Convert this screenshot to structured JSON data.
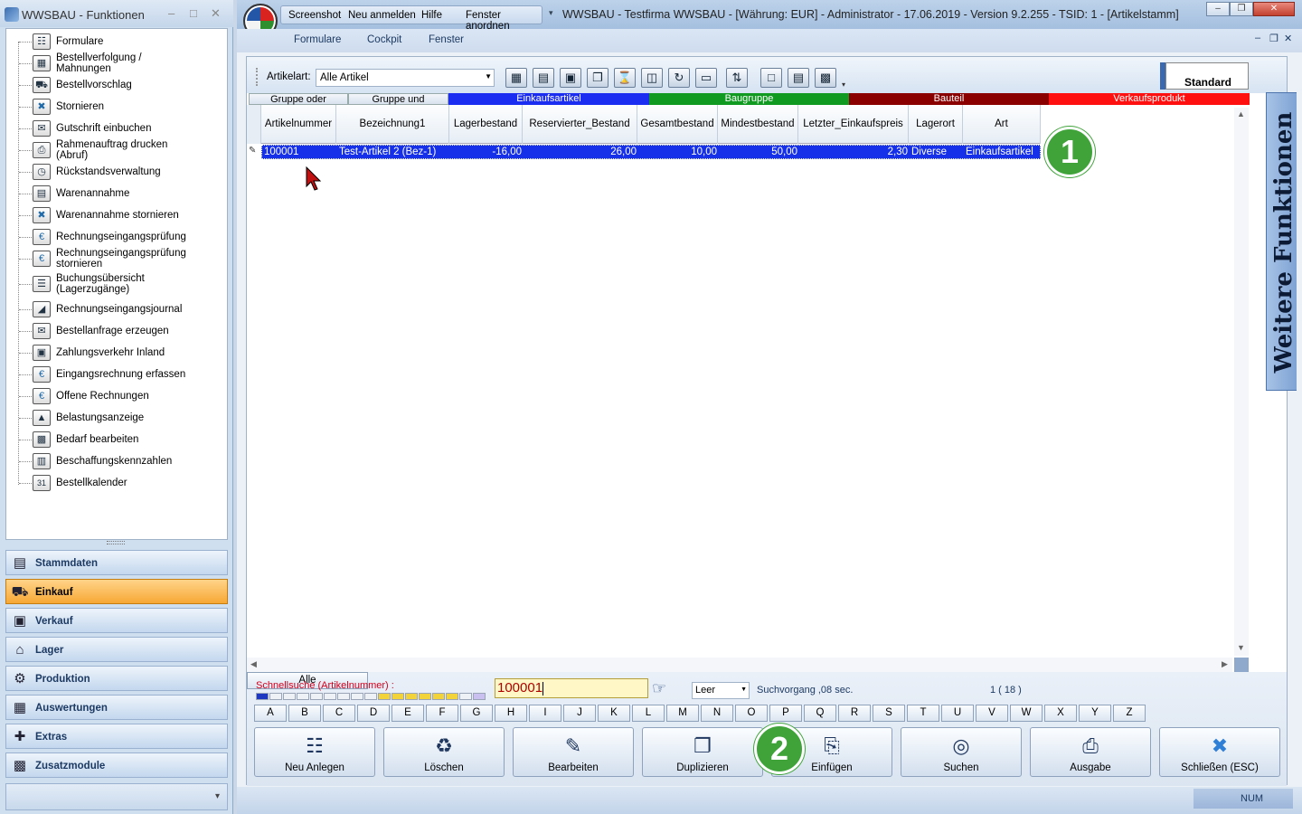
{
  "left_window": {
    "title": "WWSBAU - Funktionen",
    "tree_items": [
      {
        "label": "Formulare",
        "icon": "document-icon"
      },
      {
        "label": "Bestellverfolgung / Mahnungen",
        "icon": "map-icon"
      },
      {
        "label": "Bestellvorschlag",
        "icon": "cart-icon"
      },
      {
        "label": "Stornieren",
        "icon": "cart-cancel-icon"
      },
      {
        "label": "Gutschrift einbuchen",
        "icon": "credit-icon"
      },
      {
        "label": "Rahmenauftrag drucken (Abruf)",
        "icon": "print-doc-icon"
      },
      {
        "label": "Rückstandsverwaltung",
        "icon": "clock-icon"
      },
      {
        "label": "Warenannahme",
        "icon": "goods-icon"
      },
      {
        "label": "Warenannahme stornieren",
        "icon": "goods-cancel-icon"
      },
      {
        "label": "Rechnungseingangsprüfung",
        "icon": "euro-doc-icon"
      },
      {
        "label": "Rechnungseingangsprüfung stornieren",
        "icon": "euro-cancel-icon"
      },
      {
        "label": "Buchungsübersicht (Lagerzugänge)",
        "icon": "list-icon"
      },
      {
        "label": "Rechnungseingangsjournal",
        "icon": "journal-icon"
      },
      {
        "label": "Bestellanfrage erzeugen",
        "icon": "request-icon"
      },
      {
        "label": "Zahlungsverkehr Inland",
        "icon": "payment-icon"
      },
      {
        "label": "Eingangsrechnung erfassen",
        "icon": "euro-doc-icon"
      },
      {
        "label": "Offene Rechnungen",
        "icon": "euro-doc-icon"
      },
      {
        "label": "Belastungsanzeige",
        "icon": "weight-icon"
      },
      {
        "label": "Bedarf bearbeiten",
        "icon": "basket-icon"
      },
      {
        "label": "Beschaffungskennzahlen",
        "icon": "stats-icon"
      },
      {
        "label": "Bestellkalender",
        "icon": "calendar-icon"
      }
    ],
    "calendar_day": "31",
    "modules": [
      {
        "label": "Stammdaten",
        "icon": "stammdaten-icon",
        "active": false
      },
      {
        "label": "Einkauf",
        "icon": "cart-icon",
        "active": true
      },
      {
        "label": "Verkauf",
        "icon": "register-icon",
        "active": false
      },
      {
        "label": "Lager",
        "icon": "warehouse-icon",
        "active": false
      },
      {
        "label": "Produktion",
        "icon": "production-icon",
        "active": false
      },
      {
        "label": "Auswertungen",
        "icon": "analysis-icon",
        "active": false
      },
      {
        "label": "Extras",
        "icon": "extras-icon",
        "active": false
      },
      {
        "label": "Zusatzmodule",
        "icon": "modules-icon",
        "active": false
      }
    ]
  },
  "main_window": {
    "qat_items": [
      "Screenshot",
      "Neu anmelden",
      "Hilfe",
      "Fenster anordnen"
    ],
    "title": "WWSBAU - Testfirma WWSBAU - [Währung: EUR] - Administrator - 17.06.2019 - Version 9.2.255 - TSID: 1 - [Artikelstamm]",
    "menu": [
      "Formulare",
      "Cockpit",
      "Fenster"
    ],
    "toolbar": {
      "artikelart_label": "Artikelart:",
      "artikelart_value": "Alle Artikel",
      "standard_label": "Standard"
    },
    "group_headers": [
      {
        "label": "Gruppe oder",
        "color": "#e3e9f1"
      },
      {
        "label": "Gruppe und",
        "color": "#e3e9f1"
      },
      {
        "label": "Einkaufsartikel",
        "color": "#1a2df0"
      },
      {
        "label": "Baugruppe",
        "color": "#119a22"
      },
      {
        "label": "Bauteil",
        "color": "#8a0000"
      },
      {
        "label": "Verkaufsprodukt",
        "color": "#ff1010"
      }
    ],
    "columns": [
      "Artikelnummer",
      "Bezeichnung1",
      "Lagerbestand",
      "Reservierter_Bestand",
      "Gesamtbestand",
      "Mindestbestand",
      "Letzter_Einkaufspreis",
      "Lagerort",
      "Art"
    ],
    "rows": [
      {
        "artikelnummer": "100001",
        "bezeichnung1": "Test-Artikel 2 (Bez-1)",
        "lagerbestand": "-16,00",
        "reservierter_bestand": "26,00",
        "gesamtbestand": "10,00",
        "mindestbestand": "50,00",
        "letzter_einkaufspreis": "2,30",
        "lagerort": "Diverse",
        "art": "Einkaufsartikel"
      }
    ],
    "search": {
      "label": "Schnellsuche (Artikelnummer) :",
      "value": "100001",
      "mode": "Leer",
      "search_time": "Suchvorgang ,08 sec.",
      "count": "1  ( 18 )"
    },
    "letters": [
      "A",
      "B",
      "C",
      "D",
      "E",
      "F",
      "G",
      "H",
      "I",
      "J",
      "K",
      "L",
      "M",
      "N",
      "O",
      "P",
      "Q",
      "R",
      "S",
      "T",
      "U",
      "V",
      "W",
      "X",
      "Y",
      "Z"
    ],
    "all_label": "Alle",
    "actions": [
      {
        "label": "Neu Anlegen",
        "icon": "new-doc-icon"
      },
      {
        "label": "Löschen",
        "icon": "trash-icon"
      },
      {
        "label": "Bearbeiten",
        "icon": "edit-icon"
      },
      {
        "label": "Duplizieren",
        "icon": "duplicate-icon"
      },
      {
        "label": "Einfügen",
        "icon": "paste-icon"
      },
      {
        "label": "Suchen",
        "icon": "binoculars-icon"
      },
      {
        "label": "Ausgabe",
        "icon": "printer-icon"
      },
      {
        "label": "Schließen (ESC)",
        "icon": "close-x-icon"
      }
    ],
    "side_tab": "Weitere Funktionen",
    "status_num": "NUM",
    "badges": [
      "1",
      "2"
    ]
  }
}
